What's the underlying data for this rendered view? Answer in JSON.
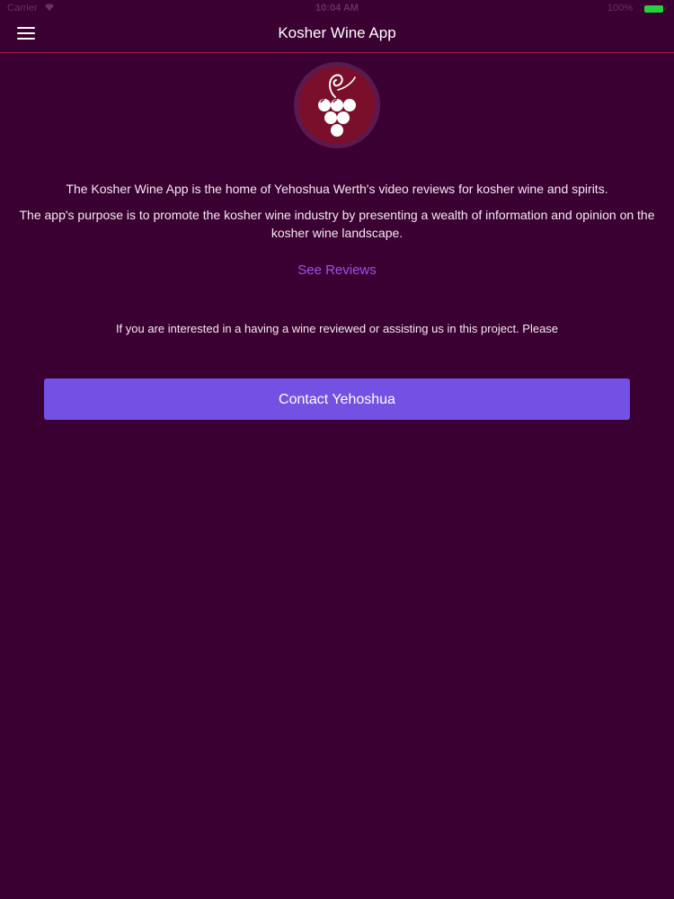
{
  "status_bar": {
    "carrier": "Carrier",
    "wifi_icon": "wifi-icon",
    "time": "10:04 AM",
    "battery_pct": "100%",
    "battery_color": "#22d33b"
  },
  "nav_bar": {
    "menu_icon": "hamburger-menu-icon",
    "title": "Kosher Wine App",
    "divider_color": "#a3154b"
  },
  "logo": {
    "icon": "grape-cluster-icon",
    "circle_color": "#7a0f2c",
    "ring_color": "#5a1a4f"
  },
  "content": {
    "intro_line1": "The Kosher Wine App is the home of Yehoshua Werth's video reviews for kosher wine and spirits.",
    "intro_line2": "The app's purpose is to promote the kosher wine industry by presenting a wealth of information and opinion on the kosher wine landscape.",
    "see_reviews_label": "See Reviews",
    "interest_text": "If you are interested in a having a wine reviewed or assisting us in this project. Please",
    "contact_button_label": "Contact Yehoshua"
  },
  "colors": {
    "background": "#3a0031",
    "link": "#9a55e8",
    "button": "#7450e3"
  }
}
